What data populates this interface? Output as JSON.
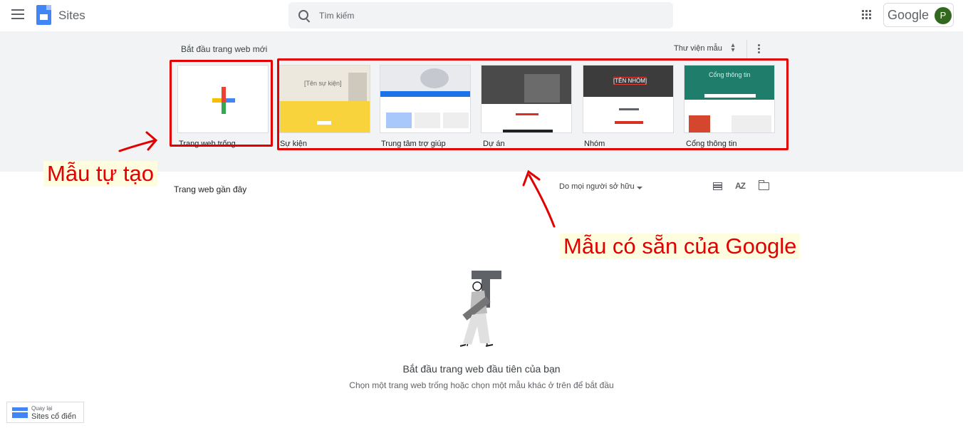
{
  "header": {
    "app_name": "Sites",
    "search_placeholder": "Tìm kiếm",
    "account_brand": "Google",
    "avatar_initial": "P"
  },
  "templates": {
    "section_title": "Bắt đầu trang web mới",
    "gallery_label": "Thư viện mẫu",
    "items": [
      {
        "label": "Trang web trống",
        "preview_title": ""
      },
      {
        "label": "Sự kiện",
        "preview_title": "[Tên sự kiện]"
      },
      {
        "label": "Trung tâm trợ giúp",
        "preview_title": ""
      },
      {
        "label": "Dự án",
        "preview_title": ""
      },
      {
        "label": "Nhóm",
        "preview_title": "[TÊN NHÓM]"
      },
      {
        "label": "Cổng thông tin",
        "preview_title": "Cổng thông tin"
      }
    ]
  },
  "annotations": {
    "custom_template_note": "Mẫu tự tạo",
    "google_templates_note": "Mẫu có sẵn của Google",
    "color": "#e30000"
  },
  "recent": {
    "title": "Trang web gần đây",
    "owner_filter": "Do mọi người sở hữu",
    "sort_label": "AZ",
    "empty_title": "Bắt đầu trang web đầu tiên của bạn",
    "empty_subtitle": "Chọn một trang web trống hoặc chọn một mẫu khác ở trên để bắt đầu"
  },
  "classic": {
    "small_label": "Quay lại",
    "main_label": "Sites cổ điển"
  }
}
